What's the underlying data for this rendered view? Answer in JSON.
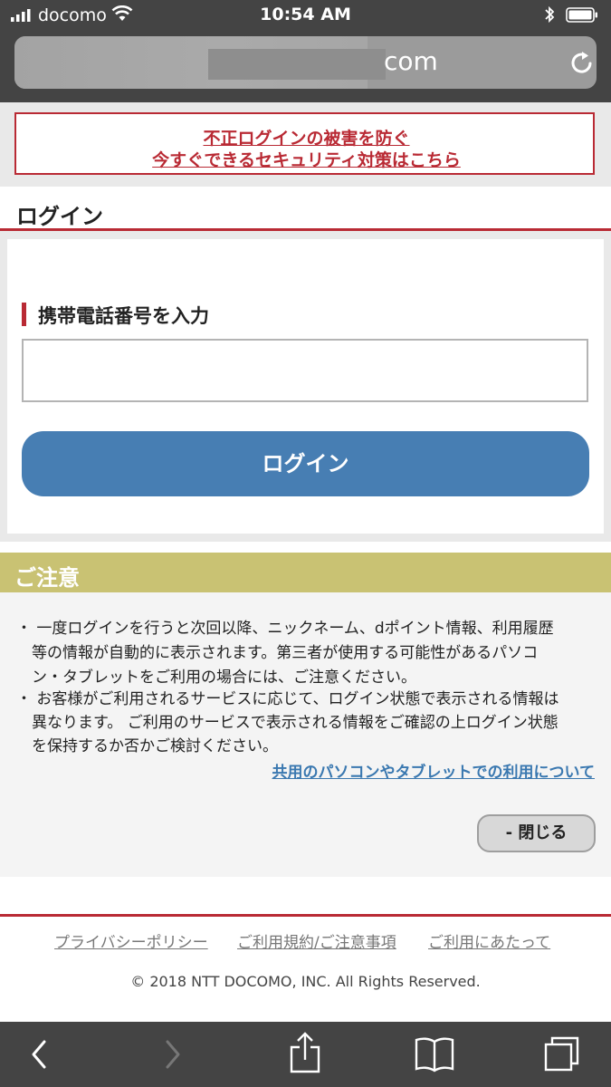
{
  "status_bar": {
    "carrier": "docomo",
    "time": "10:54 AM"
  },
  "url_bar": {
    "visible_domain_suffix": "com"
  },
  "security_banner": {
    "line1": "不正ログインの被害を防ぐ",
    "line2": "今すぐできるセキュリティ対策はこちら"
  },
  "login": {
    "heading": "ログイン",
    "phone_label": "携帯電話番号を入力",
    "phone_value": "",
    "button_label": "ログイン"
  },
  "notice": {
    "title": "ご注意",
    "bullets": [
      [
        "・ 一度ログインを行うと次回以降、ニックネーム、dポイント情報、利用履歴",
        "　等の情報が自動的に表示されます。第三者が使用する可能性があるパソコ",
        "　ン・タブレットをご利用の場合には、ご注意ください。"
      ],
      [
        "・ お客様がご利用されるサービスに応じて、ログイン状態で表示される情報は",
        "　異なります。 ご利用のサービスで表示される情報をご確認の上ログイン状態",
        "　を保持するか否かご検討ください。"
      ]
    ],
    "link": "共用のパソコンやタブレットでの利用について",
    "close_label": "- 閉じる"
  },
  "footer": {
    "links": [
      "プライバシーポリシー",
      "ご利用規約/ご注意事項",
      "ご利用にあたって"
    ],
    "copyright": "© 2018 NTT DOCOMO, INC. All Rights Reserved."
  },
  "colors": {
    "accent_red": "#b92a34",
    "button_blue": "#477eb3",
    "notice_olive": "#c9c273",
    "link_blue": "#3a78b0",
    "chrome_gray": "#444444"
  },
  "icons": [
    "signal-icon",
    "wifi-icon",
    "bluetooth-icon",
    "battery-icon",
    "reload-icon",
    "back-icon",
    "forward-icon",
    "share-icon",
    "bookmarks-icon",
    "tabs-icon"
  ]
}
